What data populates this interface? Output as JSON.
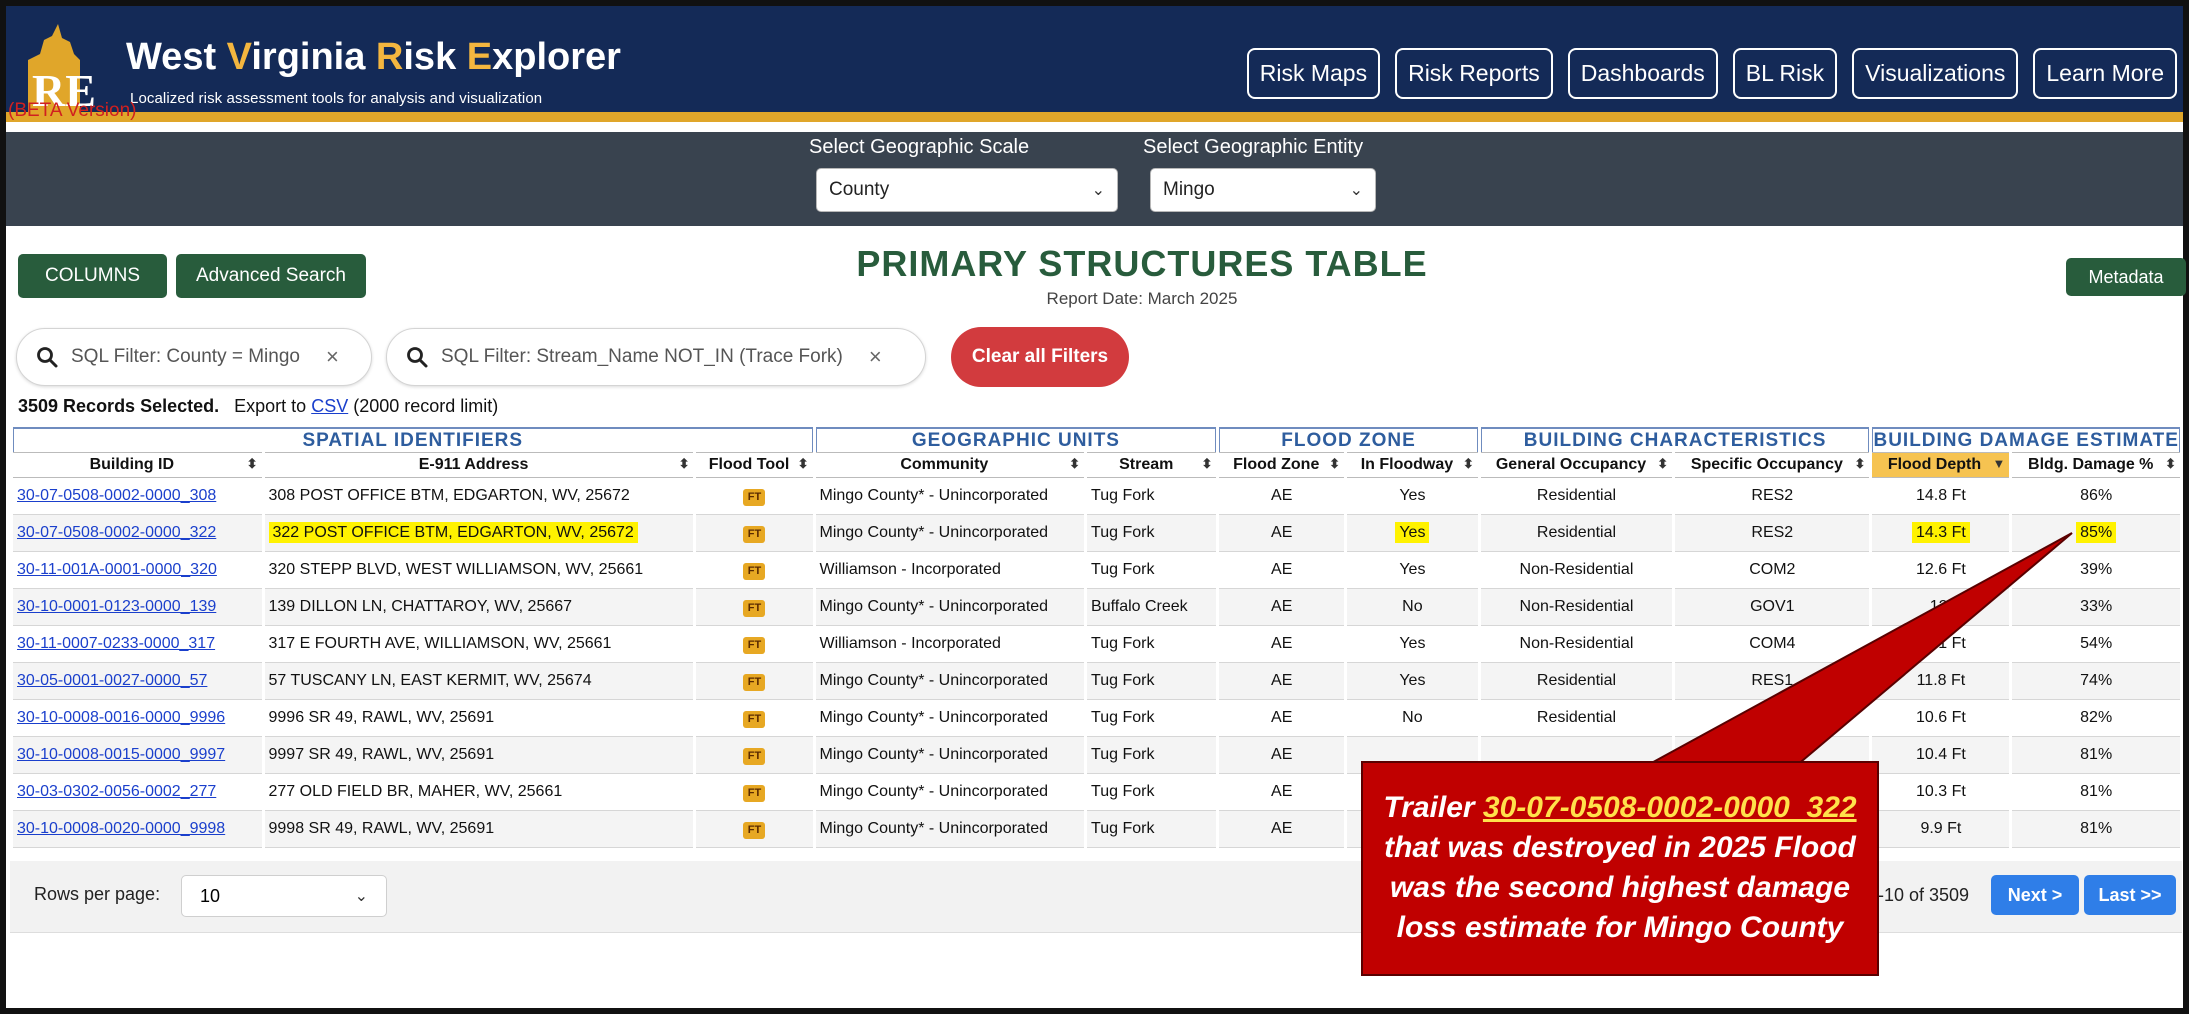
{
  "brand": {
    "title_part1": "West ",
    "title_v": "V",
    "title_part2": "irginia ",
    "title_r": "R",
    "title_part3": "isk ",
    "title_e": "E",
    "title_part4": "xplorer",
    "tagline": "Localized risk assessment tools for analysis and visualization",
    "beta": "(BETA Version)",
    "logo_text": "RE"
  },
  "nav": [
    "Risk Maps",
    "Risk Reports",
    "Dashboards",
    "BL Risk",
    "Visualizations",
    "Learn More"
  ],
  "selectors": {
    "scale_label": "Select Geographic Scale",
    "scale_value": "County",
    "entity_label": "Select Geographic Entity",
    "entity_value": "Mingo"
  },
  "toolbar": {
    "columns": "COLUMNS",
    "advanced_search": "Advanced Search",
    "metadata": "Metadata",
    "clear_filters": "Clear all Filters"
  },
  "page": {
    "title": "PRIMARY STRUCTURES TABLE",
    "report_date": "Report Date: March 2025"
  },
  "filters": [
    {
      "text": "SQL Filter: County = Mingo"
    },
    {
      "text": "SQL Filter: Stream_Name NOT_IN (Trace Fork)"
    }
  ],
  "records": {
    "selected": "3509 Records Selected.",
    "export_prefix": "Export to",
    "csv": "CSV",
    "limit": "(2000 record limit)"
  },
  "groups": [
    "SPATIAL IDENTIFIERS",
    "GEOGRAPHIC UNITS",
    "FLOOD ZONE",
    "BUILDING CHARACTERISTICS",
    "BUILDING DAMAGE ESTIMATE"
  ],
  "columns": [
    "Building ID",
    "E-911 Address",
    "Flood Tool",
    "Community",
    "Stream",
    "Flood Zone",
    "In Floodway",
    "General Occupancy",
    "Specific Occupancy",
    "Flood Depth",
    "Bldg. Damage %"
  ],
  "sort_icons": {
    "both": "⬍",
    "down": "▼"
  },
  "flood_tool_label": "FT",
  "rows": [
    {
      "id": "30-07-0508-0002-0000_308",
      "address": "308 POST OFFICE BTM, EDGARTON, WV, 25672",
      "community": "Mingo County* - Unincorporated",
      "stream": "Tug Fork",
      "zone": "AE",
      "floodway": "Yes",
      "general": "Residential",
      "specific": "RES2",
      "depth": "14.8 Ft",
      "damage": "86%"
    },
    {
      "id": "30-07-0508-0002-0000_322",
      "address": "322 POST OFFICE BTM, EDGARTON, WV, 25672",
      "community": "Mingo County* - Unincorporated",
      "stream": "Tug Fork",
      "zone": "AE",
      "floodway": "Yes",
      "general": "Residential",
      "specific": "RES2",
      "depth": "14.3 Ft",
      "damage": "85%"
    },
    {
      "id": "30-11-001A-0001-0000_320",
      "address": "320 STEPP BLVD, WEST WILLIAMSON, WV, 25661",
      "community": "Williamson - Incorporated",
      "stream": "Tug Fork",
      "zone": "AE",
      "floodway": "Yes",
      "general": "Non-Residential",
      "specific": "COM2",
      "depth": "12.6 Ft",
      "damage": "39%"
    },
    {
      "id": "30-10-0001-0123-0000_139",
      "address": "139 DILLON LN, CHATTAROY, WV, 25667",
      "community": "Mingo County* - Unincorporated",
      "stream": "Buffalo Creek",
      "zone": "AE",
      "floodway": "No",
      "general": "Non-Residential",
      "specific": "GOV1",
      "depth": "12.",
      "damage": "33%"
    },
    {
      "id": "30-11-0007-0233-0000_317",
      "address": "317 E FOURTH AVE, WILLIAMSON, WV, 25661",
      "community": "Williamson - Incorporated",
      "stream": "Tug Fork",
      "zone": "AE",
      "floodway": "Yes",
      "general": "Non-Residential",
      "specific": "COM4",
      "depth": "12.1 Ft",
      "damage": "54%"
    },
    {
      "id": "30-05-0001-0027-0000_57",
      "address": "57 TUSCANY LN, EAST KERMIT, WV, 25674",
      "community": "Mingo County* - Unincorporated",
      "stream": "Tug Fork",
      "zone": "AE",
      "floodway": "Yes",
      "general": "Residential",
      "specific": "RES1",
      "depth": "11.8 Ft",
      "damage": "74%"
    },
    {
      "id": "30-10-0008-0016-0000_9996",
      "address": "9996 SR 49, RAWL, WV, 25691",
      "community": "Mingo County* - Unincorporated",
      "stream": "Tug Fork",
      "zone": "AE",
      "floodway": "No",
      "general": "Residential",
      "specific": "",
      "depth": "10.6 Ft",
      "damage": "82%"
    },
    {
      "id": "30-10-0008-0015-0000_9997",
      "address": "9997 SR 49, RAWL, WV, 25691",
      "community": "Mingo County* - Unincorporated",
      "stream": "Tug Fork",
      "zone": "AE",
      "floodway": "",
      "general": "",
      "specific": "",
      "depth": "10.4 Ft",
      "damage": "81%"
    },
    {
      "id": "30-03-0302-0056-0002_277",
      "address": "277 OLD FIELD BR, MAHER, WV, 25661",
      "community": "Mingo County* - Unincorporated",
      "stream": "Tug Fork",
      "zone": "AE",
      "floodway": "",
      "general": "",
      "specific": "",
      "depth": "10.3 Ft",
      "damage": "81%"
    },
    {
      "id": "30-10-0008-0020-0000_9998",
      "address": "9998 SR 49, RAWL, WV, 25691",
      "community": "Mingo County* - Unincorporated",
      "stream": "Tug Fork",
      "zone": "AE",
      "floodway": "",
      "general": "",
      "specific": "",
      "depth": "9.9 Ft",
      "damage": "81%"
    }
  ],
  "pagination": {
    "rows_label": "Rows per page:",
    "rows_value": "10",
    "range": "-10 of 3509",
    "next": "Next >",
    "last": "Last >>"
  },
  "callout": {
    "line1_prefix": "Trailer",
    "line1_link": "30-07-0508-0002-0000_322",
    "line2": "that was destroyed in 2025 Flood",
    "line3": "was the second highest damage",
    "line4": "loss estimate for Mingo County"
  },
  "colors": {
    "header_bg": "#142a57",
    "accent_gold": "#e0a62a",
    "band_bg": "#39434f",
    "brand_green": "#285c3c",
    "group_blue": "#2e5d9e",
    "clear_red": "#d23b3e",
    "highlight_yellow": "#fff200",
    "callout_red": "#c00000",
    "pager_blue": "#2f7ee8"
  }
}
